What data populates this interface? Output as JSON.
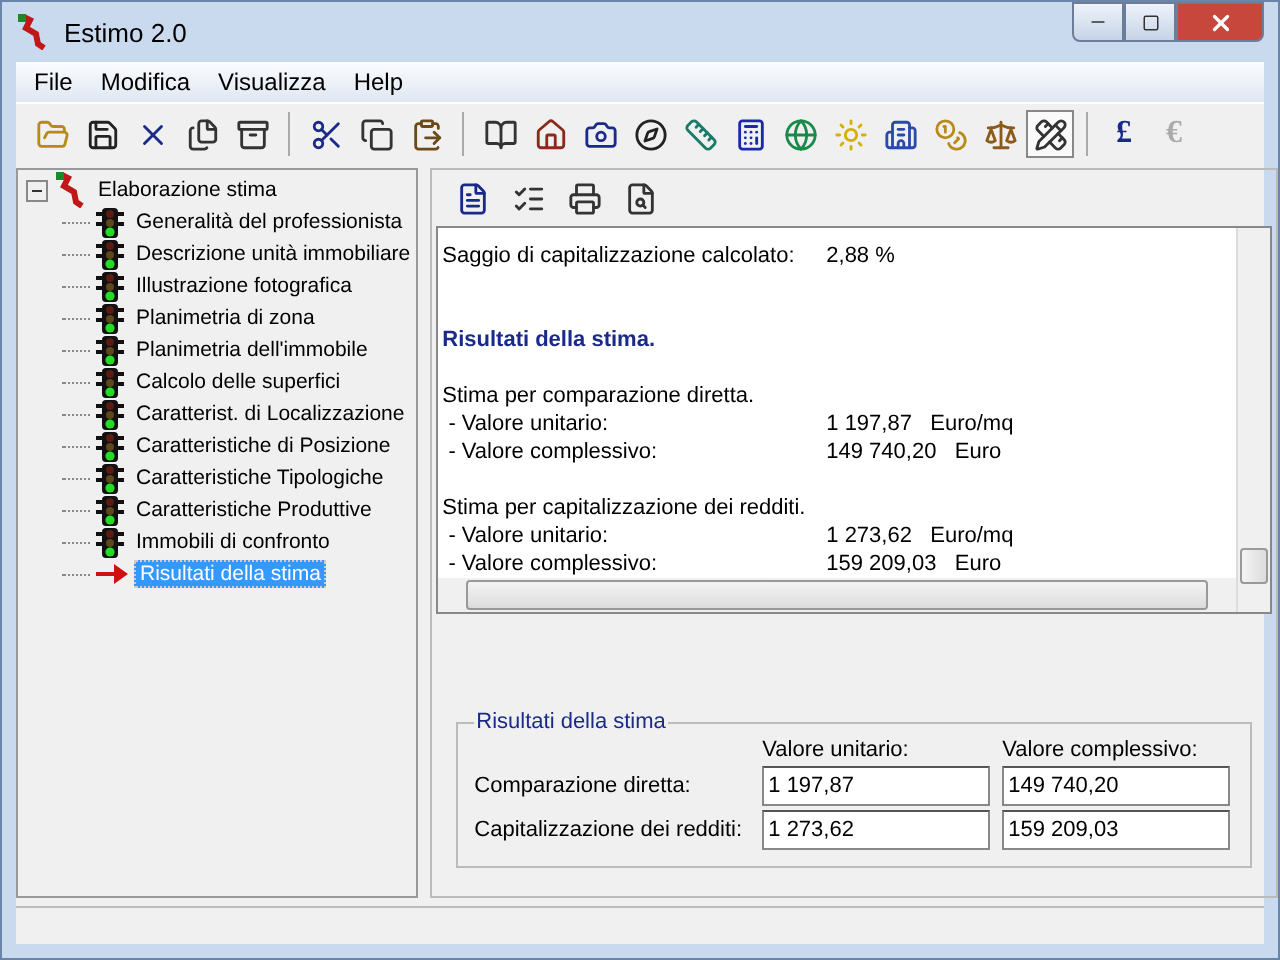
{
  "window": {
    "title": "Estimo 2.0"
  },
  "menu": [
    "File",
    "Modifica",
    "Visualizza",
    "Help"
  ],
  "toolbar": [
    {
      "pressed": false,
      "disabled": false
    },
    {
      "pressed": false,
      "disabled": false
    },
    {
      "pressed": false,
      "disabled": false
    },
    {
      "pressed": false,
      "disabled": false
    },
    {
      "pressed": false,
      "disabled": false
    },
    {
      "pressed": false,
      "disabled": false
    },
    {
      "pressed": false,
      "disabled": false
    },
    {
      "pressed": false,
      "disabled": false
    },
    {
      "pressed": false,
      "disabled": false
    },
    {
      "pressed": false,
      "disabled": false
    },
    {
      "pressed": false,
      "disabled": false
    },
    {
      "pressed": false,
      "disabled": false
    },
    {
      "pressed": false,
      "disabled": false
    },
    {
      "pressed": false,
      "disabled": false
    },
    {
      "pressed": false,
      "disabled": false
    },
    {
      "pressed": false,
      "disabled": false
    },
    {
      "pressed": false,
      "disabled": false
    },
    {
      "pressed": false,
      "disabled": false
    },
    {
      "pressed": false,
      "disabled": false
    },
    {
      "pressed": true,
      "disabled": false
    },
    {
      "label": "£",
      "pressed": false,
      "disabled": false
    },
    {
      "label": "€",
      "pressed": false,
      "disabled": true
    }
  ],
  "tree": {
    "label": "Elaborazione stima",
    "expanded": true,
    "children": [
      {
        "label": "Generalità del professionista",
        "kind": "light",
        "selected": false
      },
      {
        "label": "Descrizione unità immobiliare",
        "kind": "light",
        "selected": false
      },
      {
        "label": "Illustrazione fotografica",
        "kind": "light",
        "selected": false
      },
      {
        "label": "Planimetria di zona",
        "kind": "light",
        "selected": false
      },
      {
        "label": "Planimetria dell'immobile",
        "kind": "light",
        "selected": false
      },
      {
        "label": "Calcolo delle superfici",
        "kind": "light",
        "selected": false
      },
      {
        "label": "Caratterist. di Localizzazione",
        "kind": "light",
        "selected": false
      },
      {
        "label": "Caratteristiche di Posizione",
        "kind": "light",
        "selected": false
      },
      {
        "label": "Caratteristiche Tipologiche",
        "kind": "light",
        "selected": false
      },
      {
        "label": "Caratteristiche Produttive",
        "kind": "light",
        "selected": false
      },
      {
        "label": "Immobili di confronto",
        "kind": "light",
        "selected": false
      },
      {
        "label": "Risultati della stima",
        "kind": "arrow",
        "selected": true
      }
    ]
  },
  "report": {
    "lines": [
      {
        "kind": "pair",
        "label": "Saggio di capitalizzazione calcolato:",
        "value": "2,88 %"
      },
      {
        "kind": "blank"
      },
      {
        "kind": "blank"
      },
      {
        "kind": "heading",
        "label": "Risultati della stima."
      },
      {
        "kind": "blank"
      },
      {
        "kind": "text",
        "label": "Stima per comparazione diretta."
      },
      {
        "kind": "pair",
        "label": " - Valore unitario:",
        "value": "1 197,87   Euro/mq"
      },
      {
        "kind": "pair",
        "label": " - Valore complessivo:",
        "value": "149 740,20   Euro"
      },
      {
        "kind": "blank"
      },
      {
        "kind": "text",
        "label": "Stima per capitalizzazione dei redditi."
      },
      {
        "kind": "pair",
        "label": " - Valore unitario:",
        "value": "1 273,62   Euro/mq"
      },
      {
        "kind": "pair",
        "label": " - Valore complessivo:",
        "value": "159 209,03   Euro"
      }
    ]
  },
  "results": {
    "title": "Risultati della stima",
    "columns": [
      "Valore unitario:",
      "Valore complessivo:"
    ],
    "rows": [
      {
        "label": "Comparazione diretta:",
        "values": [
          "1 197,87",
          "149 740,20"
        ]
      },
      {
        "label": "Capitalizzazione dei redditi:",
        "values": [
          "1 273,62",
          "159 209,03"
        ]
      }
    ]
  }
}
